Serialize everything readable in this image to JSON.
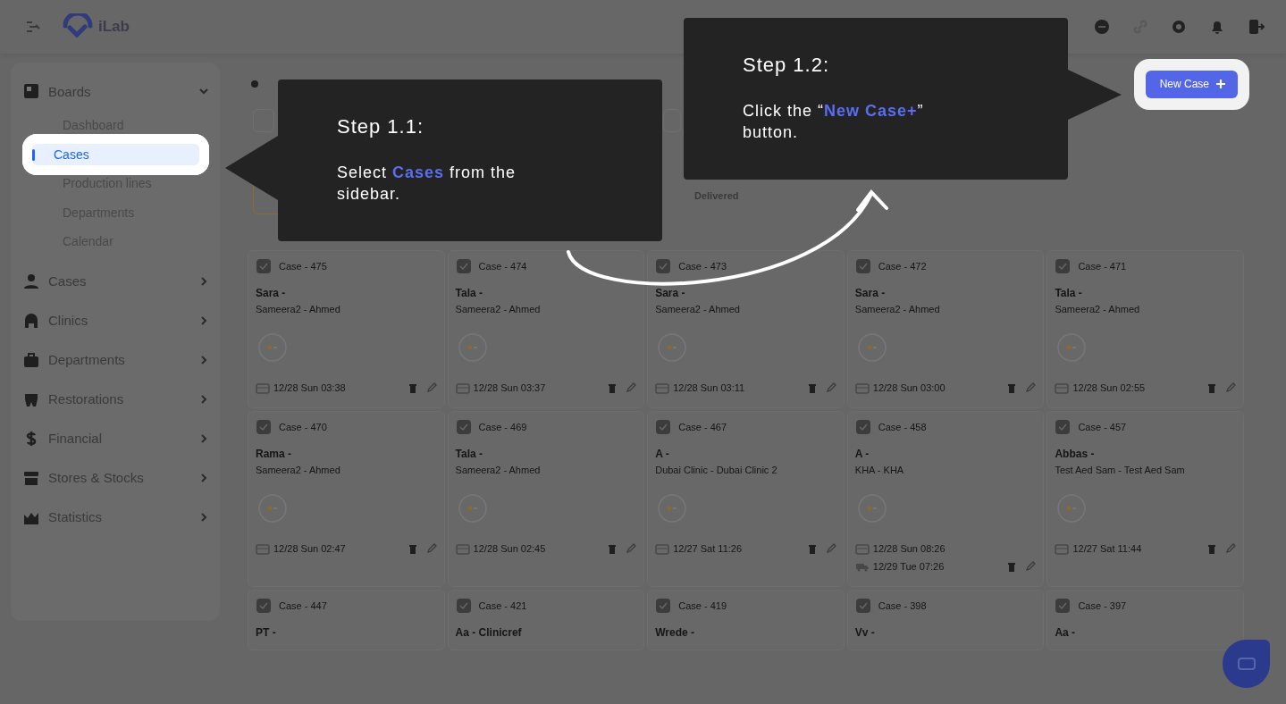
{
  "header": {
    "logo": "iLab"
  },
  "sidebar": {
    "groups": [
      {
        "label": "Boards",
        "expanded": true,
        "children": [
          {
            "label": "Dashboard",
            "selected": false
          },
          {
            "label": "Cases",
            "selected": true
          },
          {
            "label": "Production lines",
            "selected": false
          },
          {
            "label": "Departments",
            "selected": false
          },
          {
            "label": "Calendar",
            "selected": false
          }
        ]
      },
      {
        "label": "Cases",
        "expanded": false,
        "kind": "person"
      },
      {
        "label": "Clinics",
        "expanded": false,
        "kind": "building"
      },
      {
        "label": "Departments",
        "expanded": false,
        "kind": "briefcase"
      },
      {
        "label": "Restorations",
        "expanded": false,
        "kind": "tooth"
      },
      {
        "label": "Financial",
        "expanded": false,
        "kind": "dollar"
      },
      {
        "label": "Stores & Stocks",
        "expanded": false,
        "kind": "store"
      },
      {
        "label": "Statistics",
        "expanded": false,
        "kind": "chart"
      }
    ]
  },
  "main": {
    "new_case_button": "New Case",
    "status_tabs": [
      {
        "selected": true
      },
      {
        "label": "Delivered",
        "selected": false
      }
    ],
    "cards": [
      {
        "case": "Case - 475",
        "name": "Sara -",
        "clinic": "Sameera2 - Ahmed",
        "dates": [
          "12/28 Sun 03:38"
        ]
      },
      {
        "case": "Case - 474",
        "name": "Tala -",
        "clinic": "Sameera2 - Ahmed",
        "dates": [
          "12/28 Sun 03:37"
        ]
      },
      {
        "case": "Case - 473",
        "name": "Sara -",
        "clinic": "Sameera2 - Ahmed",
        "dates": [
          "12/28 Sun 03:11"
        ]
      },
      {
        "case": "Case - 472",
        "name": "Sara -",
        "clinic": "Sameera2 - Ahmed",
        "dates": [
          "12/28 Sun 03:00"
        ]
      },
      {
        "case": "Case - 471",
        "name": "Tala -",
        "clinic": "Sameera2 - Ahmed",
        "dates": [
          "12/28 Sun 02:55"
        ]
      },
      {
        "case": "Case - 470",
        "name": "Rama -",
        "clinic": "Sameera2 - Ahmed",
        "dates": [
          "12/28 Sun 02:47"
        ]
      },
      {
        "case": "Case - 469",
        "name": "Tala -",
        "clinic": "Sameera2 - Ahmed",
        "dates": [
          "12/28 Sun 02:45"
        ]
      },
      {
        "case": "Case - 467",
        "name": "A -",
        "clinic": "Dubai Clinic - Dubai Clinic 2",
        "dates": [
          "12/27 Sat 11:26"
        ]
      },
      {
        "case": "Case - 458",
        "name": "A -",
        "clinic": "KHA - KHA",
        "dates": [
          "12/28 Sun 08:26",
          "12/29 Tue 07:26"
        ]
      },
      {
        "case": "Case - 457",
        "name": "Abbas -",
        "clinic": "Test Aed Sam - Test Aed Sam",
        "dates": [
          "12/27 Sat 11:44"
        ]
      },
      {
        "case": "Case - 447",
        "name": "PT -"
      },
      {
        "case": "Case - 421",
        "name": "Aa - Clinicref"
      },
      {
        "case": "Case - 419",
        "name": "Wrede -"
      },
      {
        "case": "Case - 398",
        "name": "Vv -"
      },
      {
        "case": "Case - 397",
        "name": "Aa -"
      }
    ]
  },
  "tour": {
    "steps": [
      {
        "title": "Step 1.1:",
        "text": "Select **Cases** from the sidebar.",
        "kind": "left"
      },
      {
        "title": "Step 1.2:",
        "text": "Click the “**New Case+**” button.",
        "kind": "right"
      }
    ]
  }
}
